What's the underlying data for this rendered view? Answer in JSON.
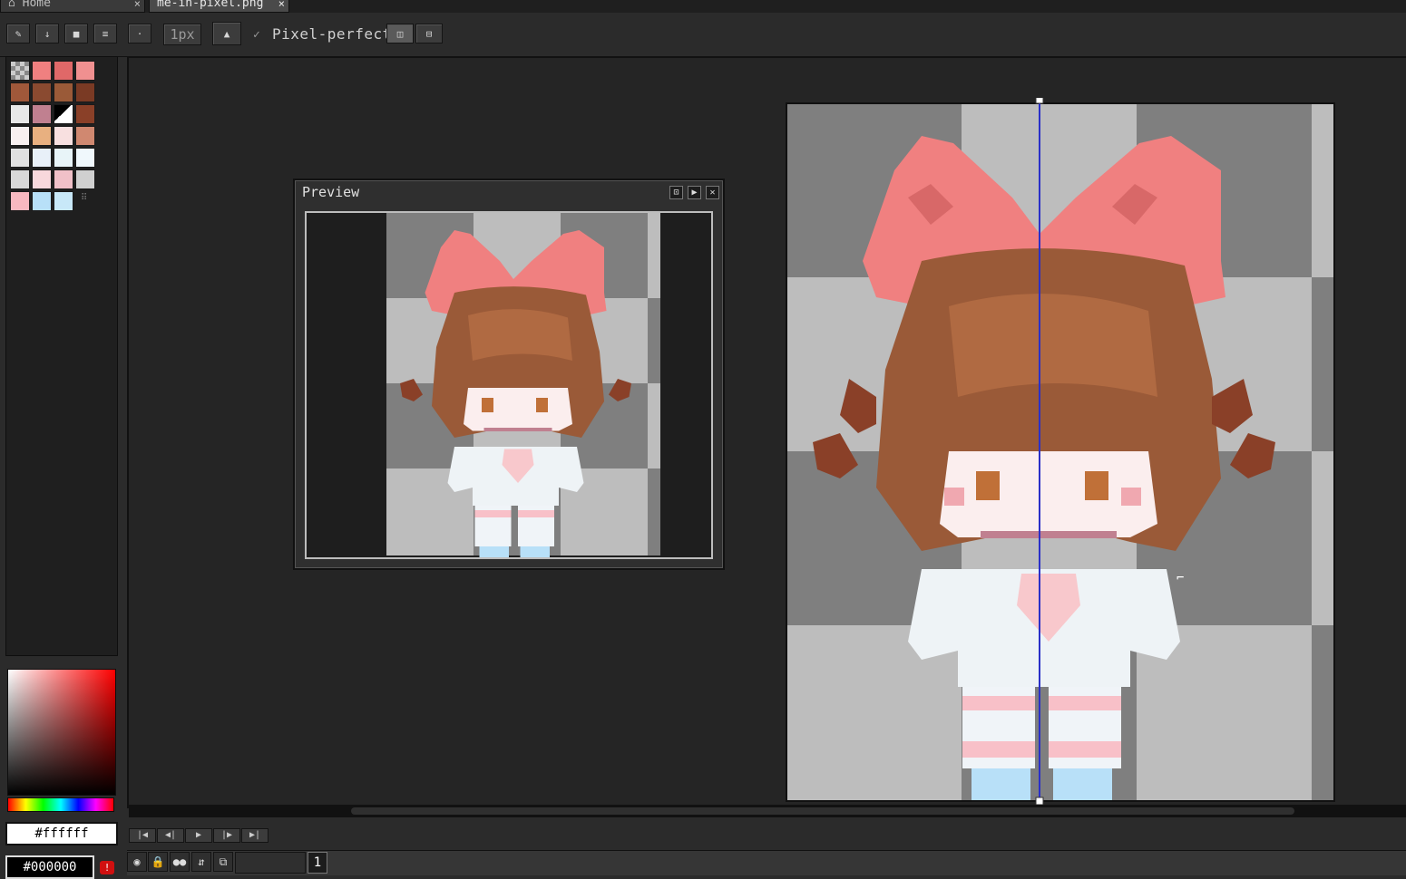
{
  "tabs": [
    {
      "label": "Home",
      "close": "×",
      "active": false
    },
    {
      "label": "me-in-pixel.png",
      "close": "×",
      "active": true
    }
  ],
  "toolbar": {
    "brush_size": "1px",
    "pixel_perfect_check": "✓",
    "pixel_perfect_label": "Pixel-perfect"
  },
  "palette": {
    "colors": [
      "#b0b0b0",
      "#f08080",
      "#e06868",
      "#f09090",
      "#a0583a",
      "#8a4a30",
      "#9a5a38",
      "#7a3a24",
      "#e8e8e8",
      "#c08090",
      "#ffffff",
      "#8a4028",
      "#f8f0f0",
      "#e8b080",
      "#f8e0e0",
      "#d08870",
      "#e0e0e0",
      "#e8f0f8",
      "#e8f4f8",
      "#f0f8fc",
      "#d8d8d8",
      "#f8d8dc",
      "#f0c0c8",
      "#d0d0d0",
      "#f8b8c0",
      "#b8e0f8",
      "#c8e8f8"
    ]
  },
  "colors": {
    "foreground": "#ffffff",
    "background": "#000000",
    "warning_icon": "!"
  },
  "preview": {
    "title": "Preview",
    "btn_fit": "⊡",
    "btn_play": "▶",
    "btn_close": "✕"
  },
  "frame_controls": {
    "first": "|◀",
    "prev": "◀|",
    "play": "▶",
    "next": "|▶",
    "last": "▶|"
  },
  "layers": {
    "frame_number": "1"
  },
  "icons": {
    "pencil": "✎",
    "arrow": "↓",
    "square": "■",
    "menu": "≡",
    "dot": "·",
    "stamp": "▲",
    "symmetry_v": "◫",
    "symmetry_h": "⊟",
    "eye": "◉",
    "lock": "🔒",
    "onion": "●●",
    "link": "⇵",
    "layers": "⧉"
  }
}
